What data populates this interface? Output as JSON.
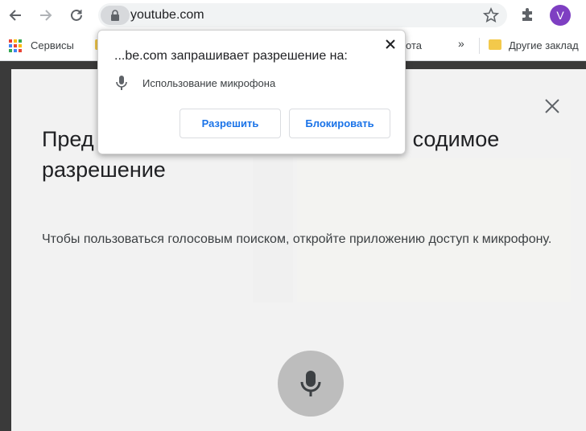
{
  "browser": {
    "url": "youtube.com",
    "avatar_letter": "V",
    "colors": {
      "avatar": "#7e3fc2",
      "accent": "#1a73e8"
    }
  },
  "bookmarks": {
    "apps_label": "Сервисы",
    "partial_label": "ота",
    "more_label": "»",
    "other_label": "Другие заклад"
  },
  "modal": {
    "title_left": "Пред",
    "title_right": "содимое",
    "title_line2": "разрешение",
    "body": "Чтобы пользоваться голосовым поиском, откройте приложению доступ к микрофону."
  },
  "permission_popup": {
    "title": "...be.com запрашивает разрешение на:",
    "permission": "Использование микрофона",
    "allow_label": "Разрешить",
    "block_label": "Блокировать"
  }
}
